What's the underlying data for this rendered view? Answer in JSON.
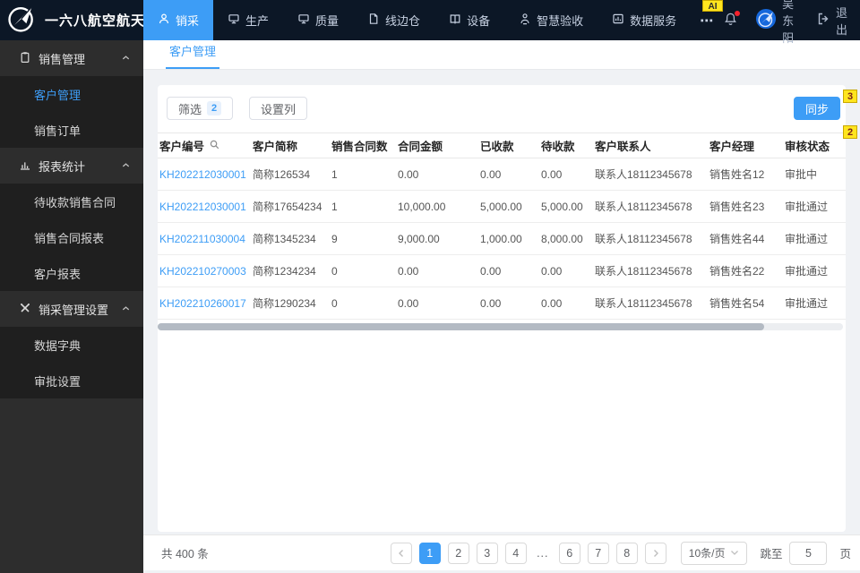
{
  "colors": {
    "accent": "#3d9df6",
    "navbar_bg": "#0c1726",
    "annotation_yellow": "#ffe51f"
  },
  "navbar": {
    "brand": "一六八航空航天",
    "items": [
      {
        "label": "销采",
        "active": true
      },
      {
        "label": "生产"
      },
      {
        "label": "质量"
      },
      {
        "label": "线边仓"
      },
      {
        "label": "设备"
      },
      {
        "label": "智慧验收"
      },
      {
        "label": "数据服务"
      }
    ],
    "more": "⋯",
    "user": "吴东阳",
    "logout": "退出"
  },
  "annotations": {
    "ai": "AI",
    "badge_top": "3",
    "badge_bottom": "2"
  },
  "sidebar": {
    "sections": [
      {
        "label": "销售管理",
        "items": [
          "客户管理",
          "销售订单"
        ]
      },
      {
        "label": "报表统计",
        "items": [
          "待收款销售合同",
          "销售合同报表",
          "客户报表"
        ]
      },
      {
        "label": "销采管理设置",
        "items": [
          "数据字典",
          "审批设置"
        ]
      }
    ]
  },
  "tabs": [
    "客户管理"
  ],
  "toolbar": {
    "filter_label": "筛选",
    "filter_badge": "2",
    "set_columns_label": "设置列",
    "sync_label": "同步"
  },
  "table": {
    "columns": [
      "客户编号",
      "客户简称",
      "销售合同数",
      "合同金额",
      "已收款",
      "待收款",
      "客户联系人",
      "客户经理",
      "审核状态"
    ],
    "rows": [
      [
        "KH202212030001",
        "简称126534",
        "1",
        "0.00",
        "0.00",
        "0.00",
        "联系人18112345678",
        "销售姓名12",
        "审批中"
      ],
      [
        "KH202212030001",
        "简称17654234",
        "1",
        "10,000.00",
        "5,000.00",
        "5,000.00",
        "联系人18112345678",
        "销售姓名23",
        "审批通过"
      ],
      [
        "KH202211030004",
        "简称1345234",
        "9",
        "9,000.00",
        "1,000.00",
        "8,000.00",
        "联系人18112345678",
        "销售姓名44",
        "审批通过"
      ],
      [
        "KH202210270003",
        "简称1234234",
        "0",
        "0.00",
        "0.00",
        "0.00",
        "联系人18112345678",
        "销售姓名22",
        "审批通过"
      ],
      [
        "KH202210260017",
        "简称1290234",
        "0",
        "0.00",
        "0.00",
        "0.00",
        "联系人18112345678",
        "销售姓名54",
        "审批通过"
      ]
    ]
  },
  "footer": {
    "total": "共 400 条",
    "pages": [
      "1",
      "2",
      "3",
      "4",
      "...",
      "6",
      "7",
      "8"
    ],
    "active_page": "1",
    "page_size": "10条/页",
    "jump_label": "跳至",
    "jump_value": "5",
    "jump_suffix": "页"
  }
}
